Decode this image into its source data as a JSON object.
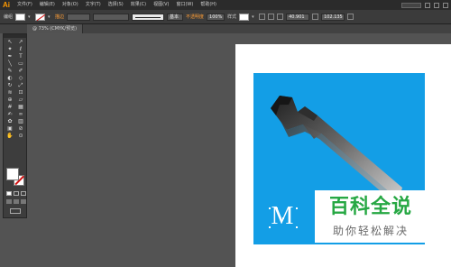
{
  "app": {
    "logo": "Ai"
  },
  "menu": {
    "items": [
      "文件(F)",
      "编辑(E)",
      "对象(O)",
      "文字(T)",
      "选择(S)",
      "效果(C)",
      "视图(V)",
      "窗口(W)",
      "帮助(H)"
    ]
  },
  "control_bar": {
    "selection_label": "编组",
    "stroke_label": "描边",
    "stroke_value": "",
    "brush_value": "基本",
    "opacity_label": "不透明度",
    "opacity_value": "100%",
    "style_label": "样式",
    "x_value": "40.901",
    "y_value": "102.135"
  },
  "document_tab": {
    "label": "@ 73% (CMYK/预览)"
  },
  "tools": [
    "selection-tool",
    "direct-selection-tool",
    "magic-wand-tool",
    "lasso-tool",
    "pen-tool",
    "type-tool",
    "line-tool",
    "rectangle-tool",
    "paintbrush-tool",
    "pencil-tool",
    "blob-brush-tool",
    "eraser-tool",
    "rotate-tool",
    "scale-tool",
    "width-tool",
    "free-transform-tool",
    "shape-builder-tool",
    "perspective-tool",
    "mesh-tool",
    "gradient-tool",
    "eyedropper-tool",
    "blend-tool",
    "symbol-sprayer-tool",
    "column-graph-tool",
    "artboard-tool",
    "slice-tool",
    "hand-tool",
    "zoom-tool"
  ],
  "tool_glyphs": [
    "↖",
    "↗",
    "✦",
    "ℓ",
    "✒",
    "T",
    "╲",
    "▭",
    "✎",
    "✐",
    "◐",
    "◇",
    "↻",
    "⤢",
    "≋",
    "⊡",
    "⊕",
    "▱",
    "#",
    "▦",
    "✍",
    "∞",
    "✿",
    "▥",
    "▣",
    "⊘",
    "✋",
    "⊙"
  ],
  "colors": {
    "canvas_bg": "#535353",
    "panel_blue": "#139ee6",
    "artboard": "#ffffff",
    "watermark_green": "#27a844",
    "menu_accent": "#ff9a00"
  },
  "canvas": {
    "text_object": "M"
  },
  "watermark": {
    "title": "百科全说",
    "subtitle": "助你轻松解决"
  }
}
